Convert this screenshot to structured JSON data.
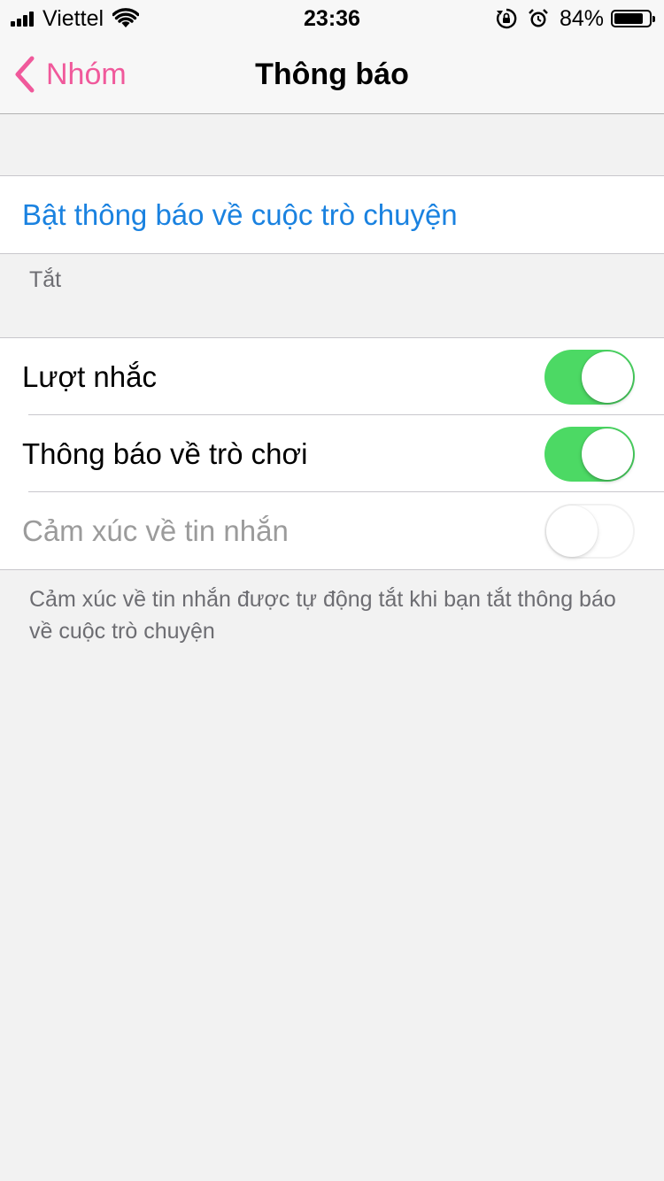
{
  "status_bar": {
    "carrier": "Viettel",
    "time": "23:36",
    "battery_percent_text": "84%",
    "battery_level": 0.84,
    "icons": [
      "signal-icon",
      "wifi-icon",
      "orientation-lock-icon",
      "alarm-icon",
      "battery-icon"
    ]
  },
  "nav": {
    "back_label": "Nhóm",
    "title": "Thông báo",
    "accent_color": "#f0599b"
  },
  "enable_section": {
    "link_label": "Bật thông báo về cuộc trò chuyện",
    "status_text": "Tắt",
    "link_color": "#1a82e0"
  },
  "settings": {
    "items": [
      {
        "label": "Lượt nhắc",
        "enabled": true,
        "on": true
      },
      {
        "label": "Thông báo về trò chơi",
        "enabled": true,
        "on": true
      },
      {
        "label": "Cảm xúc về tin nhắn",
        "enabled": false,
        "on": false
      }
    ],
    "footer_note": "Cảm xúc về tin nhắn được tự động tắt khi bạn tắt thông báo về cuộc trò chuyện",
    "toggle_on_color": "#4cd964"
  }
}
